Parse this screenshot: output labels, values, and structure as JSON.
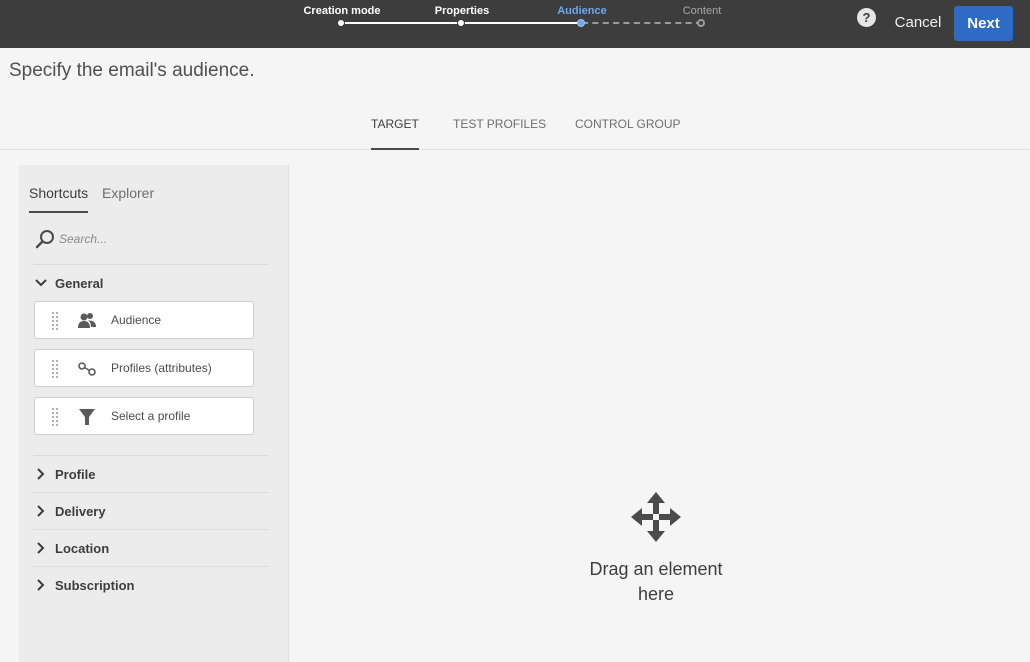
{
  "wizard": {
    "steps": [
      {
        "label": "Creation mode",
        "state": "done"
      },
      {
        "label": "Properties",
        "state": "done"
      },
      {
        "label": "Audience",
        "state": "active"
      },
      {
        "label": "Content",
        "state": "future"
      }
    ],
    "help_label": "?",
    "cancel_label": "Cancel",
    "next_label": "Next"
  },
  "page": {
    "title": "Specify the email's audience."
  },
  "tabs": [
    {
      "label": "TARGET",
      "active": true
    },
    {
      "label": "TEST PROFILES",
      "active": false
    },
    {
      "label": "CONTROL GROUP",
      "active": false
    }
  ],
  "palette": {
    "tabs": [
      {
        "label": "Shortcuts",
        "active": true
      },
      {
        "label": "Explorer",
        "active": false
      }
    ],
    "search": {
      "placeholder": "Search..."
    },
    "sections": [
      {
        "label": "General",
        "expanded": true,
        "items": [
          {
            "label": "Audience",
            "icon": "audience-icon"
          },
          {
            "label": "Profiles (attributes)",
            "icon": "profiles-attributes-icon"
          },
          {
            "label": "Select a profile",
            "icon": "filter-icon"
          }
        ]
      },
      {
        "label": "Profile",
        "expanded": false
      },
      {
        "label": "Delivery",
        "expanded": false
      },
      {
        "label": "Location",
        "expanded": false
      },
      {
        "label": "Subscription",
        "expanded": false
      }
    ]
  },
  "dropzone": {
    "text": "Drag an element here",
    "icon": "move-icon"
  },
  "colors": {
    "topbar": "#3d3d3d",
    "accent": "#2d6bc4",
    "active_step": "#6fa8ec",
    "background": "#f5f5f5"
  }
}
